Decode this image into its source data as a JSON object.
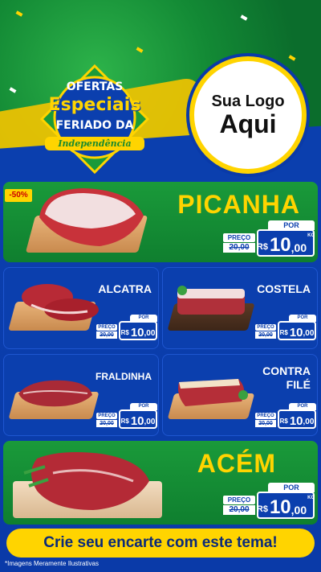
{
  "header": {
    "badge_line1": "OFERTAS",
    "badge_line2": "Especiais",
    "badge_line3": "FERIADO DA",
    "badge_line4": "Independência",
    "logo_line1": "Sua Logo",
    "logo_line2": "Aqui"
  },
  "discount_tag": "-50%",
  "price_labels": {
    "por": "POR",
    "preco": "PREÇO",
    "currency": "R$",
    "unit": "KG"
  },
  "products": [
    {
      "name": "PICANHA",
      "old_price": "20,00",
      "price_int": "10",
      "price_dec": ",00"
    },
    {
      "name": "ALCATRA",
      "old_price": "20,00",
      "price_int": "10",
      "price_dec": ",00"
    },
    {
      "name": "COSTELA",
      "old_price": "20,00",
      "price_int": "10",
      "price_dec": ",00"
    },
    {
      "name": "FRALDINHA",
      "old_price": "20,00",
      "price_int": "10",
      "price_dec": ",00"
    },
    {
      "name_line1": "CONTRA",
      "name_line2": "FILÉ",
      "old_price": "20,00",
      "price_int": "10",
      "price_dec": ",00"
    },
    {
      "name": "ACÉM",
      "old_price": "20,00",
      "price_int": "10",
      "price_dec": ",00"
    }
  ],
  "footer": {
    "cta": "Crie seu encarte com este tema!",
    "disclaimer": "*Imagens Meramente Ilustrativas"
  },
  "colors": {
    "green": "#1a9a3a",
    "blue": "#0b3fae",
    "yellow": "#ffd400"
  }
}
